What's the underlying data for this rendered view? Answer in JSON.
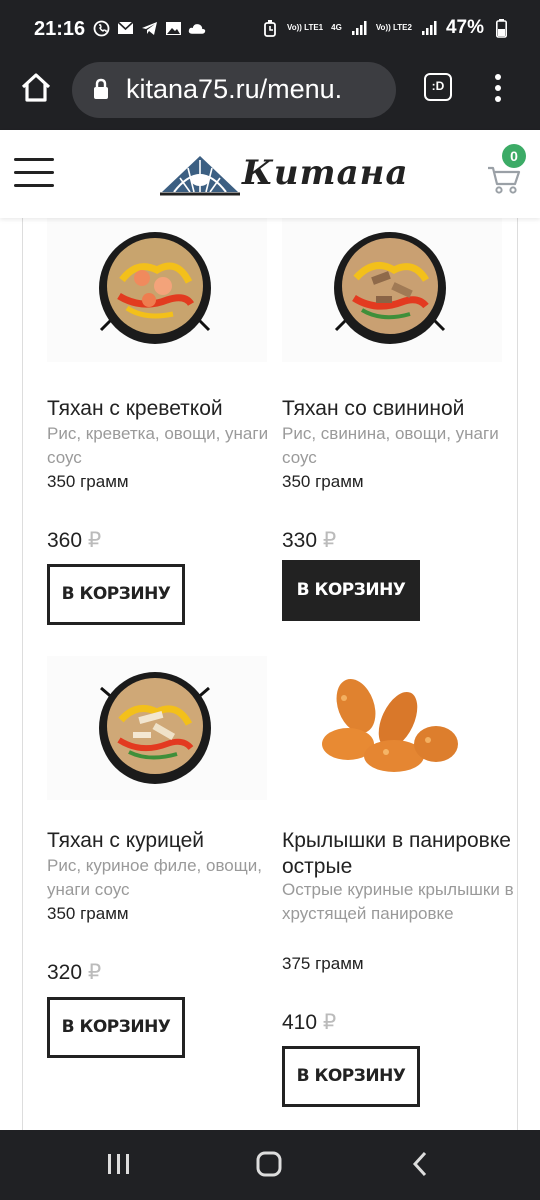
{
  "status": {
    "time": "21:16",
    "battery": "47%",
    "net1": "Vo)) LTE1",
    "net2": "Vo)) LTE2",
    "net_4g": "4G"
  },
  "browser": {
    "url": "kitana75.ru/menu.",
    "tab_label": ":D"
  },
  "header": {
    "logo_text": "Китана",
    "cart_count": "0"
  },
  "products": [
    {
      "title": "Тяхан с креветкой",
      "desc": "Рис, креветка, овощи, унаги соус",
      "weight": "350 грамм",
      "price": "360",
      "currency": "₽",
      "button": "В КОРЗИНУ"
    },
    {
      "title": "Тяхан со свининой",
      "desc": "Рис, свинина, овощи, унаги соус",
      "weight": "350 грамм",
      "price": "330",
      "currency": "₽",
      "button": "В КОРЗИНУ"
    },
    {
      "title": "Тяхан с курицей",
      "desc": "Рис, куриное филе, овощи, унаги соус",
      "weight": "350 грамм",
      "price": "320",
      "currency": "₽",
      "button": "В КОРЗИНУ"
    },
    {
      "title": "Крылышки в панировке острые",
      "desc": "Острые куриные крылышки в хрустящей панировке",
      "weight": "375 грамм",
      "price": "410",
      "currency": "₽",
      "button": "В КОРЗИНУ"
    }
  ],
  "colors": {
    "accent_badge": "#3cab66",
    "dark": "#222222",
    "system_bar": "#202124"
  }
}
